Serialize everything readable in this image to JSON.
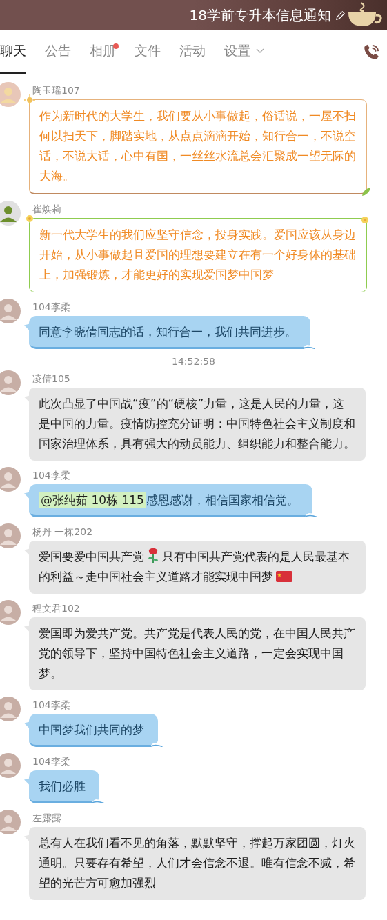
{
  "header": {
    "title": "18学前专升本信息通知"
  },
  "tabs": [
    {
      "label": "聊天",
      "selected": true,
      "badge": false,
      "dropdown": false
    },
    {
      "label": "公告",
      "selected": false,
      "badge": false,
      "dropdown": false
    },
    {
      "label": "相册",
      "selected": false,
      "badge": true,
      "dropdown": false
    },
    {
      "label": "文件",
      "selected": false,
      "badge": false,
      "dropdown": false
    },
    {
      "label": "活动",
      "selected": false,
      "badge": false,
      "dropdown": false
    },
    {
      "label": "设置",
      "selected": false,
      "badge": false,
      "dropdown": true
    }
  ],
  "messages": [
    {
      "kind": "autumn",
      "sender": "陶玉瑶107",
      "parts": [
        {
          "kind": "text",
          "text": "作为新时代的大学生，我们要从小事做起，俗话说，一屋不扫何以扫天下，脚踏实地，从点点滴滴开始，知行合一，不说空话，不说大话，心中有国，一丝丝水流总会汇聚成一望无际的大海。"
        }
      ]
    },
    {
      "kind": "spring",
      "sender": "崔焕莉",
      "parts": [
        {
          "kind": "text",
          "text": "新一代大学生的我们应坚守信念，投身实践。爱国应该从身边开始，从小事做起且爱国的理想要建立在有一个好身体的基础上，加强锻炼，才能更好的实现爱国梦中国梦"
        }
      ]
    },
    {
      "kind": "sky",
      "sender": "104李柔",
      "parts": [
        {
          "kind": "text",
          "text": "同意李晓倩同志的话，知行合一，我们共同进步。"
        }
      ]
    },
    {
      "kind": "time",
      "text": "14:52:58"
    },
    {
      "kind": "plain",
      "sender": "凌倩105",
      "parts": [
        {
          "kind": "text",
          "text": "此次凸显了中国战“疫”的“硬核”力量，这是人民的力量，这是中国的力量。疫情防控充分证明：中国特色社会主义制度和国家治理体系，具有强大的动员能力、组织能力和整合能力。"
        }
      ]
    },
    {
      "kind": "sky",
      "sender": "104李柔",
      "parts": [
        {
          "kind": "mention",
          "text": "@张纯茹 10栋 115"
        },
        {
          "kind": "text",
          "text": "感恩感谢，相信国家相信党。"
        }
      ]
    },
    {
      "kind": "plain",
      "sender": "杨丹 一栋202",
      "parts": [
        {
          "kind": "text",
          "text": "爱国要爱中国共产党"
        },
        {
          "kind": "rose"
        },
        {
          "kind": "text",
          "text": "只有中国共产党代表的是人民最基本的利益～走中国社会主义道路才能实现中国梦"
        },
        {
          "kind": "flag"
        }
      ]
    },
    {
      "kind": "plain",
      "sender": "程文君102",
      "parts": [
        {
          "kind": "text",
          "text": "爱国即为爱共产党。共产党是代表人民的党，在中国人民共产党的领导下，坚持中国特色社会主义道路，一定会实现中国梦。"
        }
      ]
    },
    {
      "kind": "sky",
      "sender": "104李柔",
      "parts": [
        {
          "kind": "text",
          "text": "中国梦我们共同的梦"
        }
      ]
    },
    {
      "kind": "sky",
      "sender": "104李柔",
      "parts": [
        {
          "kind": "text",
          "text": "我们必胜"
        }
      ]
    },
    {
      "kind": "plain",
      "sender": "左露露",
      "parts": [
        {
          "kind": "text",
          "text": "总有人在我们看不见的角落，默默坚守，撑起万家团圆，灯火通明。只要存有希望，人们才会信念不退。唯有信念不减，希望的光芒方可愈加强烈"
        }
      ]
    }
  ]
}
